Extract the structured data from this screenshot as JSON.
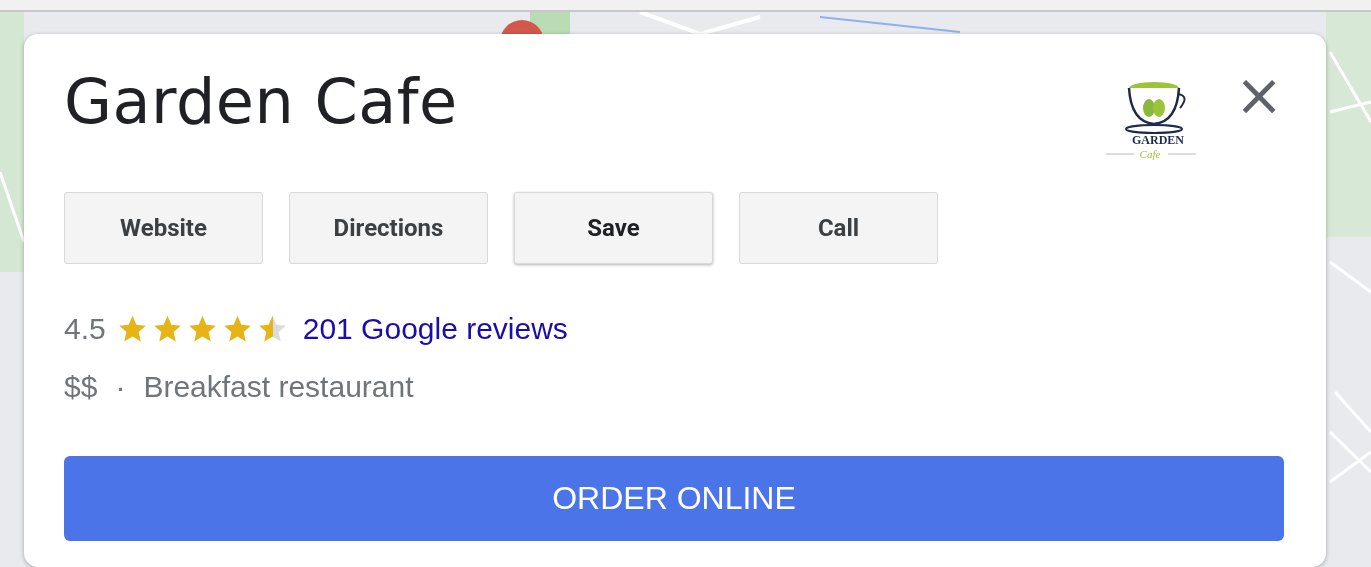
{
  "place": {
    "name": "Garden Cafe",
    "logo": {
      "line_1": "GARDEN",
      "line_2": "Cafe"
    },
    "close": "×"
  },
  "actions": [
    {
      "label": "Website",
      "hovered": false
    },
    {
      "label": "Directions",
      "hovered": false
    },
    {
      "label": "Save",
      "hovered": true
    },
    {
      "label": "Call",
      "hovered": false
    }
  ],
  "rating": {
    "score": "4.5",
    "stars": 4.5,
    "reviews": "201 Google reviews"
  },
  "details": {
    "price": "$$",
    "separator": "·",
    "category": "Breakfast restaurant"
  },
  "order_button": "ORDER ONLINE"
}
